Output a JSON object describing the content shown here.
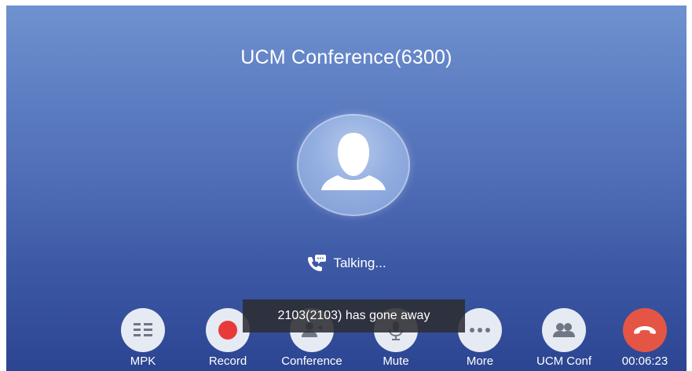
{
  "call": {
    "title": "UCM Conference(6300)",
    "status": "Talking..."
  },
  "toast": {
    "message": "2103(2103) has gone away"
  },
  "buttons": [
    {
      "label": "MPK",
      "icon": "mpk-grid-icon"
    },
    {
      "label": "Record",
      "icon": "record-dot-icon"
    },
    {
      "label": "Conference",
      "icon": "add-person-icon"
    },
    {
      "label": "Mute",
      "icon": "microphone-icon"
    },
    {
      "label": "More",
      "icon": "more-dots-icon"
    },
    {
      "label": "UCM Conf",
      "icon": "group-icon"
    },
    {
      "label": "00:06:23",
      "icon": "end-call-icon"
    }
  ],
  "colors": {
    "record": "#e83a3a",
    "end_call": "#e45545",
    "icon_gray": "#6f7684"
  }
}
